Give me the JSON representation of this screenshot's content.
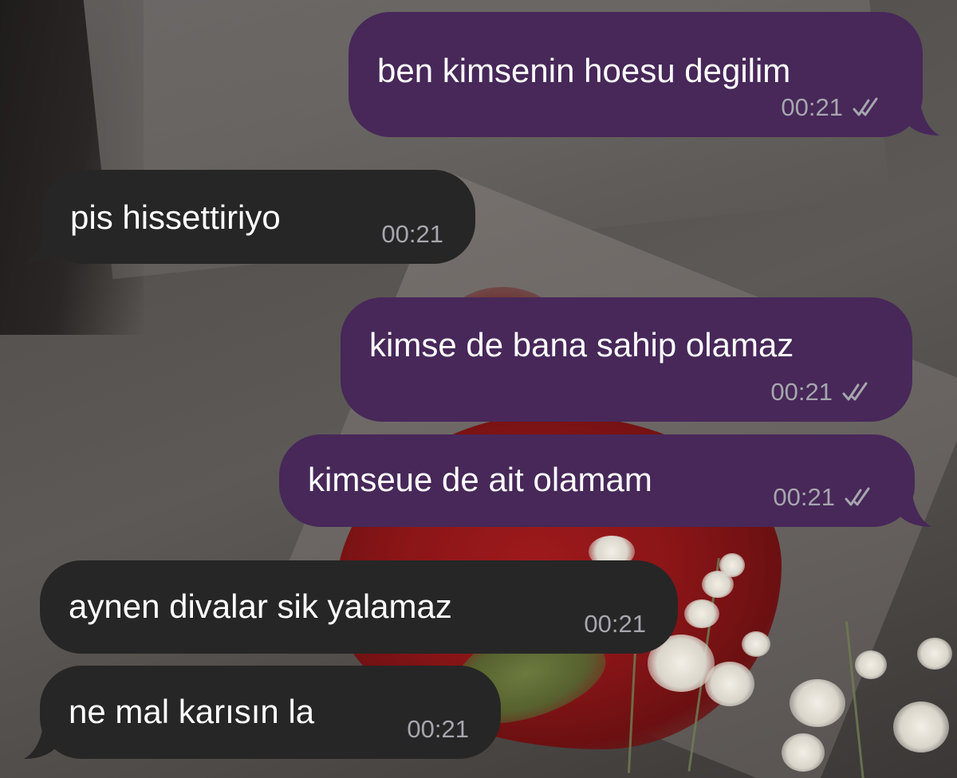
{
  "messages": [
    {
      "text": "ben kimsenin hoesu degilim",
      "time": "00:21",
      "direction": "outgoing",
      "status": "read"
    },
    {
      "text": "pis hissettiriyo",
      "time": "00:21",
      "direction": "incoming"
    },
    {
      "text": "kimse de bana sahip olamaz",
      "time": "00:21",
      "direction": "outgoing",
      "status": "read"
    },
    {
      "text": "kimseue de ait olamam",
      "time": "00:21",
      "direction": "outgoing",
      "status": "read"
    },
    {
      "text": "aynen divalar sik yalamaz",
      "time": "00:21",
      "direction": "incoming"
    },
    {
      "text": "ne mal karısın la",
      "time": "00:21",
      "direction": "incoming"
    }
  ],
  "colors": {
    "outgoing_bubble": "#472859",
    "incoming_bubble": "#262626",
    "message_text": "#ffffff",
    "time_text": "#a6a6ad"
  },
  "icons": {
    "read_status": "double-check-icon"
  }
}
